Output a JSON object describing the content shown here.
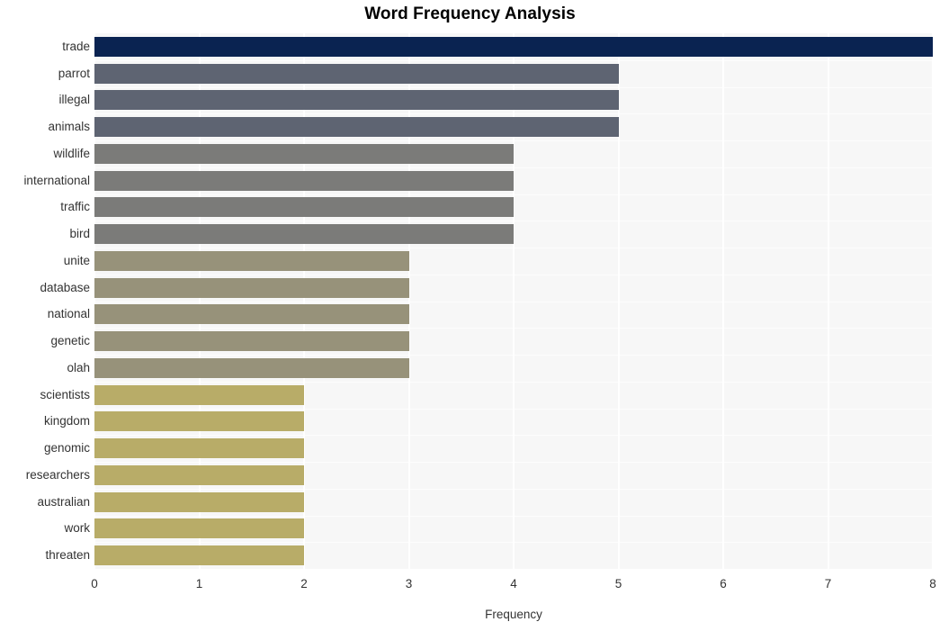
{
  "chart_data": {
    "type": "bar",
    "orientation": "horizontal",
    "title": "Word Frequency Analysis",
    "xlabel": "Frequency",
    "ylabel": "",
    "xlim": [
      0,
      8
    ],
    "xticks": [
      0,
      1,
      2,
      3,
      4,
      5,
      6,
      7,
      8
    ],
    "xtick_labels": [
      "0",
      "1",
      "2",
      "3",
      "4",
      "5",
      "6",
      "7",
      "8"
    ],
    "grid": true,
    "grid_axis": "x",
    "legend": false,
    "categories": [
      "trade",
      "parrot",
      "illegal",
      "animals",
      "wildlife",
      "international",
      "traffic",
      "bird",
      "unite",
      "database",
      "national",
      "genetic",
      "olah",
      "scientists",
      "kingdom",
      "genomic",
      "researchers",
      "australian",
      "work",
      "threaten"
    ],
    "values": [
      8,
      5,
      5,
      5,
      4,
      4,
      4,
      4,
      3,
      3,
      3,
      3,
      3,
      2,
      2,
      2,
      2,
      2,
      2,
      2
    ],
    "bar_colors": [
      "#0a2351",
      "#5e6472",
      "#5e6472",
      "#5e6472",
      "#7b7b79",
      "#7b7b79",
      "#7b7b79",
      "#7b7b79",
      "#97927a",
      "#97927a",
      "#97927a",
      "#97927a",
      "#97927a",
      "#b8ac68",
      "#b8ac68",
      "#b8ac68",
      "#b8ac68",
      "#b8ac68",
      "#b8ac68",
      "#b8ac68"
    ]
  },
  "style": {
    "plot_background": "#f7f7f7",
    "page_background": "#ffffff",
    "gridline_color": "#ffffff",
    "tick_label_color": "#333333",
    "title_color": "#000000"
  }
}
